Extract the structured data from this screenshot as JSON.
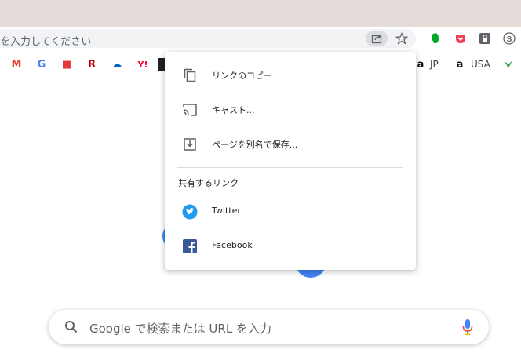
{
  "omnibox": {
    "placeholder_text": "を入力してください"
  },
  "bookmarks": [
    {
      "icon": "gmail-icon",
      "glyph": "M",
      "color": "#ea4335"
    },
    {
      "icon": "google-icon",
      "glyph": "G",
      "color": "#4285f4"
    },
    {
      "icon": "cube-icon",
      "glyph": "■",
      "color": "#e53935"
    },
    {
      "icon": "rakuten-icon",
      "glyph": "R",
      "color": "#bf0000"
    },
    {
      "icon": "onedrive-icon",
      "glyph": "☁",
      "color": "#0364b8"
    },
    {
      "icon": "yahoo-icon",
      "glyph": "Y!",
      "color": "#ff0033"
    }
  ],
  "bookmark_labels": {
    "jp": "JP",
    "usa": "USA"
  },
  "menu": {
    "copy_link": "リンクのコピー",
    "cast": "キャスト...",
    "save_page": "ページを別名で保存...",
    "share_section": "共有するリンク",
    "twitter": "Twitter",
    "facebook": "Facebook"
  },
  "search": {
    "placeholder": "Google で検索または URL を入力"
  },
  "colors": {
    "accent": "#4285f4",
    "twitter": "#1d9bf0",
    "facebook": "#1877f2",
    "titlebar": "#e4dcd8"
  }
}
